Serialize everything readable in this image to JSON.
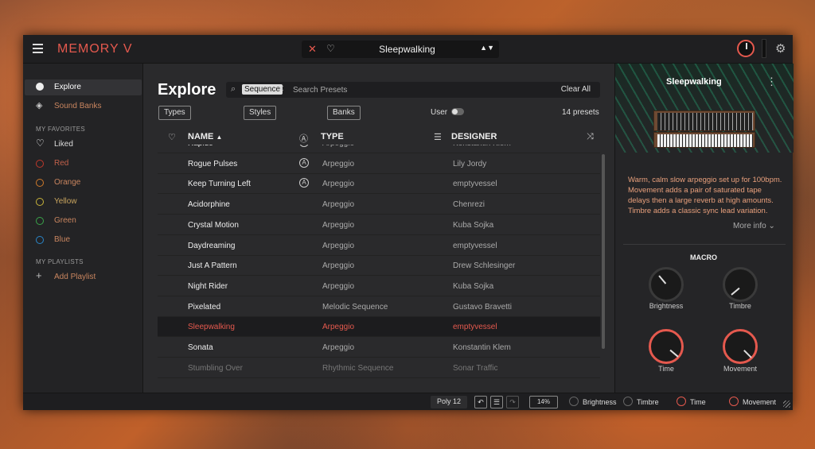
{
  "topbar": {
    "app_title": "MEMORY V",
    "preset_name": "Sleepwalking",
    "nav_arrows": "▲▼"
  },
  "sidebar": {
    "items": [
      {
        "label": "Explore"
      },
      {
        "label": "Sound Banks"
      }
    ],
    "favorites_header": "MY FAVORITES",
    "favorites": [
      {
        "label": "Liked",
        "color": "#e0e0e0"
      },
      {
        "label": "Red",
        "color": "#c0392b"
      },
      {
        "label": "Orange",
        "color": "#d07a2a"
      },
      {
        "label": "Yellow",
        "color": "#c9b43a"
      },
      {
        "label": "Green",
        "color": "#3aa54a"
      },
      {
        "label": "Blue",
        "color": "#2a86c9"
      }
    ],
    "playlists_header": "MY PLAYLISTS",
    "add_playlist": "Add Playlist"
  },
  "main": {
    "title": "Explore",
    "search": {
      "chip": "Sequence",
      "placeholder": "Search Presets",
      "clear": "Clear All"
    },
    "filters": {
      "types": "Types",
      "styles": "Styles",
      "banks": "Banks"
    },
    "user_label": "User",
    "count": "14 presets",
    "columns": {
      "name": "NAME",
      "type": "TYPE",
      "designer": "DESIGNER"
    },
    "rows": [
      {
        "name": "Rapide",
        "type": "Arpeggio",
        "designer": "Konstantin Klem",
        "tag": "A"
      },
      {
        "name": "Rogue Pulses",
        "type": "Arpeggio",
        "designer": "Lily Jordy",
        "tag": "A"
      },
      {
        "name": "Keep Turning Left",
        "type": "Arpeggio",
        "designer": "emptyvessel",
        "tag": "A"
      },
      {
        "name": "Acidorphine",
        "type": "Arpeggio",
        "designer": "Chenrezi",
        "tag": ""
      },
      {
        "name": "Crystal Motion",
        "type": "Arpeggio",
        "designer": "Kuba Sojka",
        "tag": ""
      },
      {
        "name": "Daydreaming",
        "type": "Arpeggio",
        "designer": "emptyvessel",
        "tag": ""
      },
      {
        "name": "Just A Pattern",
        "type": "Arpeggio",
        "designer": "Drew Schlesinger",
        "tag": ""
      },
      {
        "name": "Night Rider",
        "type": "Arpeggio",
        "designer": "Kuba Sojka",
        "tag": ""
      },
      {
        "name": "Pixelated",
        "type": "Melodic Sequence",
        "designer": "Gustavo Bravetti",
        "tag": ""
      },
      {
        "name": "Sleepwalking",
        "type": "Arpeggio",
        "designer": "emptyvessel",
        "tag": ""
      },
      {
        "name": "Sonata",
        "type": "Arpeggio",
        "designer": "Konstantin Klem",
        "tag": ""
      },
      {
        "name": "Stumbling Over",
        "type": "Rhythmic Sequence",
        "designer": "Sonar Traffic",
        "tag": ""
      }
    ]
  },
  "right_panel": {
    "title": "Sleepwalking",
    "description": "Warm, calm slow arpeggio set up for 100bpm. Movement adds a pair of saturated tape delays then a large reverb at high amounts. Timbre adds a classic sync lead variation.",
    "more_info": "More info",
    "macro_title": "MACRO",
    "knobs": [
      {
        "label": "Brightness"
      },
      {
        "label": "Timbre"
      },
      {
        "label": "Time"
      },
      {
        "label": "Movement"
      }
    ]
  },
  "bottombar": {
    "poly": "Poly 12",
    "zoom": "14%",
    "brightness": "Brightness",
    "timbre": "Timbre",
    "time": "Time",
    "movement": "Movement"
  },
  "colors": {
    "accent": "#e5594e"
  }
}
